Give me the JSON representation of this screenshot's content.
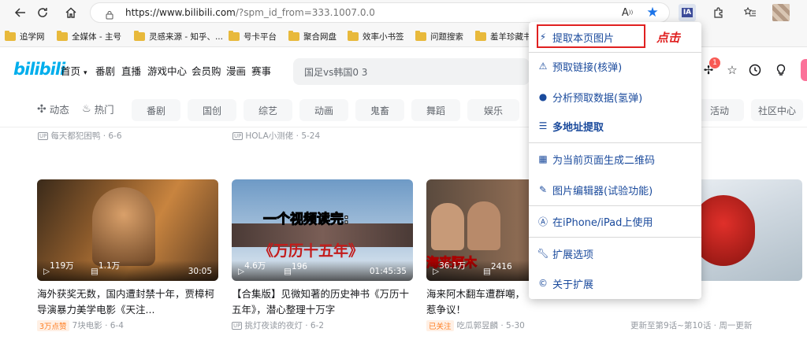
{
  "browser": {
    "url_host": "https://www.bilibili.com",
    "url_rest": "/?spm_id_from=333.1007.0.0",
    "extension_label": "IA",
    "bookmarks": [
      "追学网",
      "全媒体 - 主号",
      "灵感来源 - 知乎、...",
      "号卡平台",
      "聚合网盘",
      "效率小书签",
      "问题搜索",
      "羞羊珍藏书"
    ]
  },
  "site": {
    "logo": "bilibili",
    "nav": [
      "首页",
      "番剧",
      "直播",
      "游戏中心",
      "会员购",
      "漫画",
      "赛事"
    ],
    "search_placeholder": "国足vs韩国0 3",
    "notification_count": "1",
    "channel_links": [
      "动态",
      "热门"
    ],
    "channel_pills": [
      "番剧",
      "国创",
      "综艺",
      "动画",
      "鬼畜",
      "舞蹈",
      "娱乐",
      "活动",
      "社区中心"
    ]
  },
  "feed": {
    "top_meta": [
      {
        "author": "每天都犯困鸭",
        "date": "6-6"
      },
      {
        "author": "HOLA小测佬",
        "date": "5-24"
      }
    ],
    "cards": [
      {
        "views": "119万",
        "danmaku": "1.1万",
        "duration": "30:05",
        "title": "海外获奖无数，国内遭封禁十年，贾樟柯导演暴力美学电影《天注...",
        "tag": "3万点赞",
        "author": "7块电影",
        "date": "6-4"
      },
      {
        "views": "4.6万",
        "danmaku": "196",
        "duration": "01:45:35",
        "overlay1": "一个视频读完:",
        "overlay2": "《万历十五年》",
        "title": "【合集版】见微知著的历史神书《万历十五年》，潜心整理十万字",
        "author": "挑灯夜读的夜灯",
        "date": "6-2"
      },
      {
        "views": "36.1万",
        "danmaku": "2416",
        "overlay1": "海来阿木",
        "title": "海来阿木翻车遭群嘲，",
        "title2": "惹争议！",
        "tag": "已关注",
        "author": "吃瓜郭昱麟",
        "date": "5-30"
      },
      {
        "footer": "更新至第9话~第10话 · 周一更新"
      }
    ]
  },
  "menu": {
    "items": [
      {
        "icon": "bolt-icon",
        "label": "提取本页图片"
      },
      {
        "icon": "warning-icon",
        "label": "预取链接(核弹)"
      },
      {
        "icon": "bomb-icon",
        "label": "分析预取数据(氢弹)"
      },
      {
        "icon": "list-icon",
        "label": "多地址提取"
      },
      {
        "icon": "qrcode-icon",
        "label": "为当前页面生成二维码"
      },
      {
        "icon": "edit-icon",
        "label": "图片编辑器(试验功能)"
      },
      {
        "icon": "apple-icon",
        "label": "在iPhone/iPad上使用"
      },
      {
        "icon": "wrench-icon",
        "label": "扩展选项"
      },
      {
        "icon": "copyright-icon",
        "label": "关于扩展"
      }
    ],
    "annotation": "点击"
  },
  "colors": {
    "accent": "#00aeec",
    "menu_text": "#1a4a9c",
    "highlight": "#e02020",
    "bookmark_folder": "#e8b93b"
  }
}
